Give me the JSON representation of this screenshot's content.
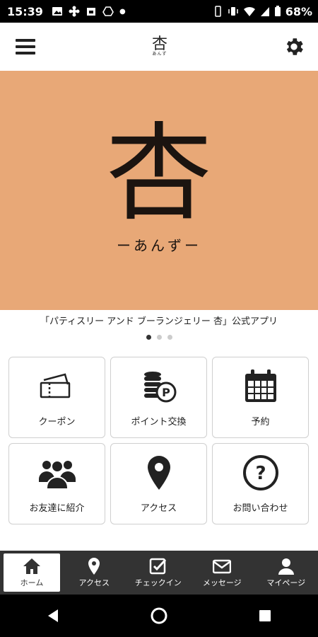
{
  "status_bar": {
    "time": "15:39",
    "battery": "68%"
  },
  "header": {
    "logo_text": "杏",
    "logo_sub": "あんず"
  },
  "banner": {
    "kanji": "杏",
    "kana": "ーあんずー",
    "caption": "「パティスリー アンド ブーランジェリー 杏」公式アプリ",
    "page_count": 3,
    "current_page": 1
  },
  "menu": {
    "tiles": [
      {
        "label": "クーポン",
        "icon": "coupon-icon"
      },
      {
        "label": "ポイント交換",
        "icon": "point-coins-icon"
      },
      {
        "label": "予約",
        "icon": "calendar-icon"
      },
      {
        "label": "お友達に紹介",
        "icon": "group-icon"
      },
      {
        "label": "アクセス",
        "icon": "map-pin-icon"
      },
      {
        "label": "お問い合わせ",
        "icon": "question-icon"
      }
    ]
  },
  "tabbar": {
    "tabs": [
      {
        "label": "ホーム",
        "icon": "home-icon",
        "active": true
      },
      {
        "label": "アクセス",
        "icon": "map-pin-icon"
      },
      {
        "label": "チェックイン",
        "icon": "checkbox-icon"
      },
      {
        "label": "メッセージ",
        "icon": "mail-icon"
      },
      {
        "label": "マイページ",
        "icon": "person-icon"
      }
    ]
  },
  "colors": {
    "banner_bg": "#e8a877",
    "tabbar_bg": "#333333"
  }
}
